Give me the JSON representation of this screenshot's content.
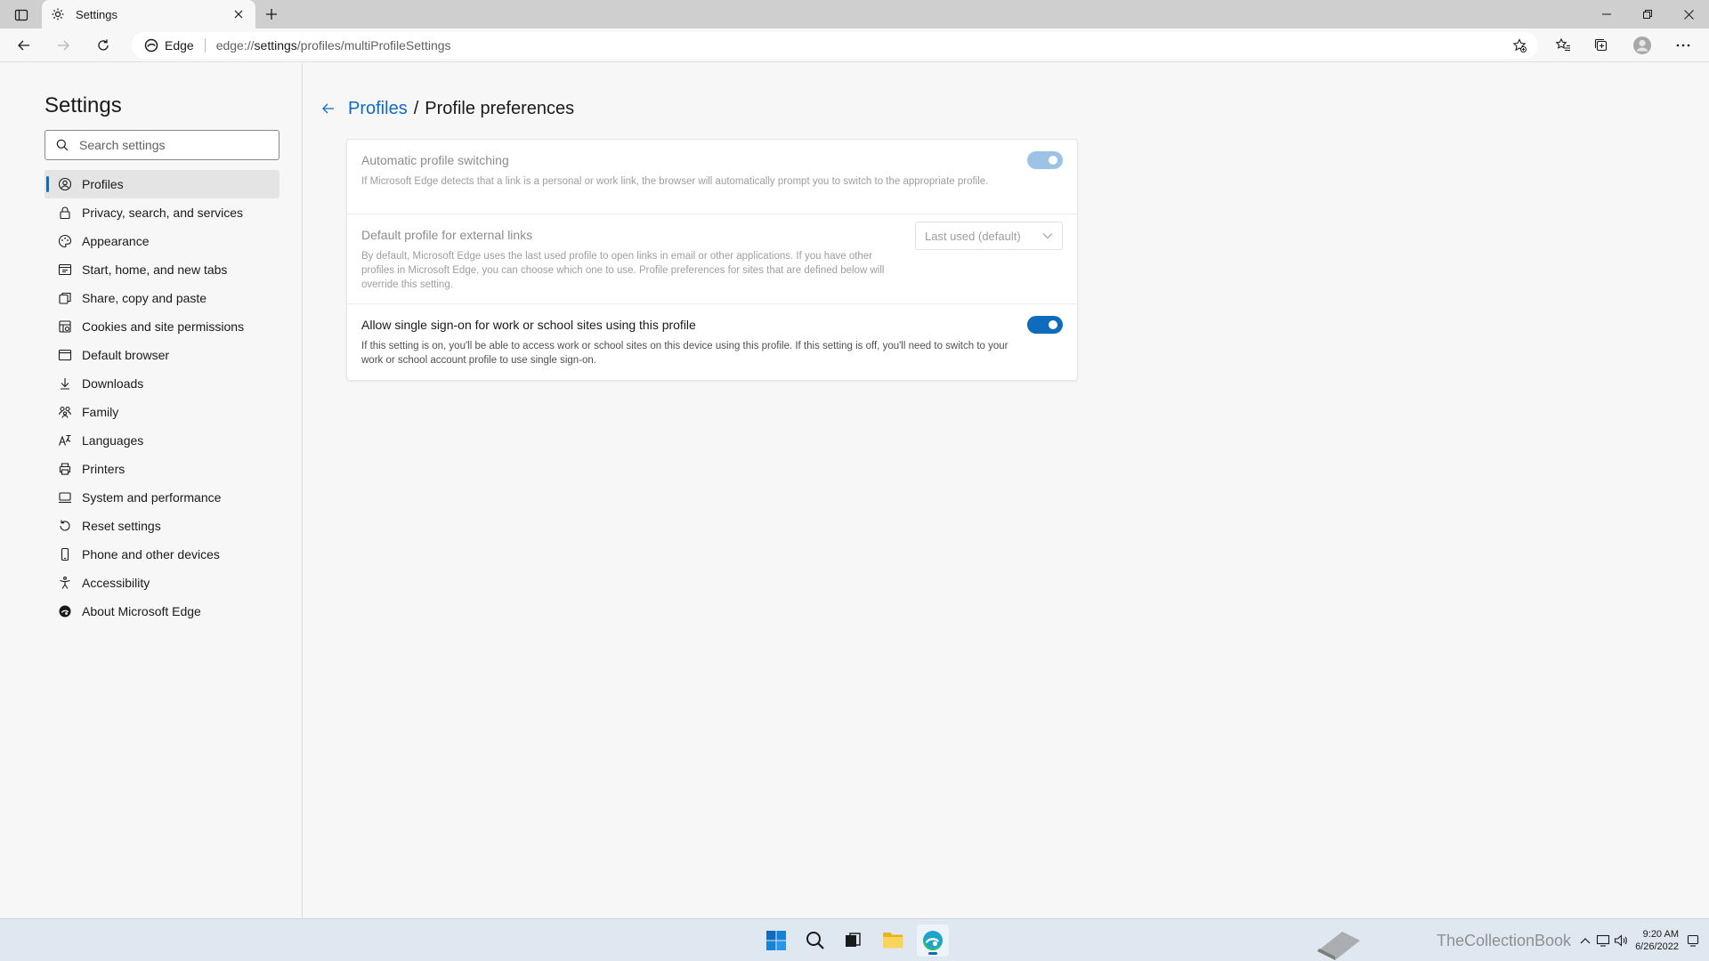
{
  "browser": {
    "tab_title": "Settings",
    "site_chip": "Edge",
    "url_prefix": "edge://",
    "url_host": "settings",
    "url_path": "/profiles/multiProfileSettings"
  },
  "sidebar": {
    "title": "Settings",
    "search_placeholder": "Search settings",
    "items": [
      {
        "label": "Profiles",
        "icon": "profile-icon",
        "active": true
      },
      {
        "label": "Privacy, search, and services",
        "icon": "lock-icon"
      },
      {
        "label": "Appearance",
        "icon": "appearance-icon"
      },
      {
        "label": "Start, home, and new tabs",
        "icon": "start-icon"
      },
      {
        "label": "Share, copy and paste",
        "icon": "share-icon"
      },
      {
        "label": "Cookies and site permissions",
        "icon": "cookies-icon"
      },
      {
        "label": "Default browser",
        "icon": "browser-icon"
      },
      {
        "label": "Downloads",
        "icon": "download-icon"
      },
      {
        "label": "Family",
        "icon": "family-icon"
      },
      {
        "label": "Languages",
        "icon": "languages-icon"
      },
      {
        "label": "Printers",
        "icon": "printer-icon"
      },
      {
        "label": "System and performance",
        "icon": "system-icon"
      },
      {
        "label": "Reset settings",
        "icon": "reset-icon"
      },
      {
        "label": "Phone and other devices",
        "icon": "phone-icon"
      },
      {
        "label": "Accessibility",
        "icon": "accessibility-icon"
      },
      {
        "label": "About Microsoft Edge",
        "icon": "edge-icon"
      }
    ]
  },
  "main": {
    "breadcrumb_link": "Profiles",
    "breadcrumb_sep": "/",
    "breadcrumb_current": "Profile preferences",
    "settings": [
      {
        "title": "Automatic profile switching",
        "description": "If Microsoft Edge detects that a link is a personal or work link, the browser will automatically prompt you to switch to the appropriate profile.",
        "toggle_on": true,
        "disabled": true
      },
      {
        "title": "Default profile for external links",
        "description": "By default, Microsoft Edge uses the last used profile to open links in email or other applications. If you have other profiles in Microsoft Edge, you can choose which one to use. Profile preferences for sites that are defined below will override this setting.",
        "select_value": "Last used (default)",
        "disabled": true
      },
      {
        "title": "Allow single sign-on for work or school sites using this profile",
        "description": "If this setting is on, you'll be able to access work or school sites on this device using this profile. If this setting is off, you'll need to switch to your work or school account profile to use single sign-on.",
        "toggle_on": true,
        "disabled": false
      }
    ]
  },
  "taskbar": {
    "watermark_text": "TheCollectionBook",
    "time": "9:20 AM",
    "date": "6/26/2022"
  },
  "colors": {
    "accent": "#0f6cbd",
    "accent_disabled": "#9cc3e6"
  }
}
